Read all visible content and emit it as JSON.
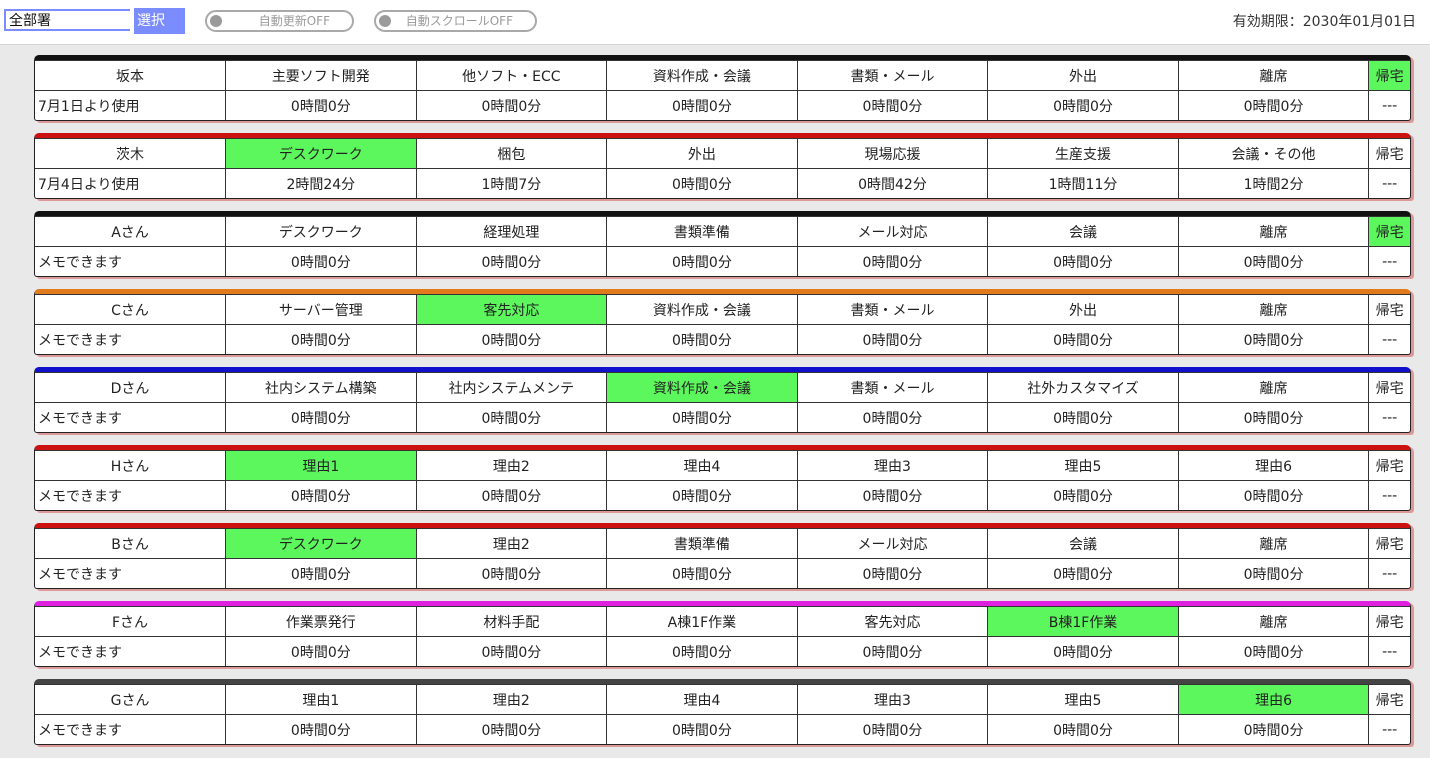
{
  "header": {
    "dept_value": "全部署",
    "select_label": "選択",
    "auto_update_label": "自動更新OFF",
    "auto_scroll_label": "自動スクロールOFF",
    "expiry_text": "有効期限：2030年01月01日"
  },
  "colors": {
    "active_cell": "#5cf75c",
    "select_button": "#7b8cff"
  },
  "panels": [
    {
      "name": "坂本",
      "memo": "7月1日より使用",
      "color": "#111111",
      "active": 7,
      "reasons": [
        "主要ソフト開発",
        "他ソフト・ECC",
        "資料作成・会議",
        "書類・メール",
        "外出",
        "離席"
      ],
      "times": [
        "0時間0分",
        "0時間0分",
        "0時間0分",
        "0時間0分",
        "0時間0分",
        "0時間0分"
      ],
      "home_label": "帰宅",
      "home_value": "---"
    },
    {
      "name": "茨木",
      "memo": "7月4日より使用",
      "color": "#cc1111",
      "active": 1,
      "reasons": [
        "デスクワーク",
        "梱包",
        "外出",
        "現場応援",
        "生産支援",
        "会議・その他"
      ],
      "times": [
        "2時間24分",
        "1時間7分",
        "0時間0分",
        "0時間42分",
        "1時間11分",
        "1時間2分"
      ],
      "home_label": "帰宅",
      "home_value": "---"
    },
    {
      "name": "Aさん",
      "memo": "メモできます",
      "color": "#111111",
      "active": 7,
      "reasons": [
        "デスクワーク",
        "経理処理",
        "書類準備",
        "メール対応",
        "会議",
        "離席"
      ],
      "times": [
        "0時間0分",
        "0時間0分",
        "0時間0分",
        "0時間0分",
        "0時間0分",
        "0時間0分"
      ],
      "home_label": "帰宅",
      "home_value": "---"
    },
    {
      "name": "Cさん",
      "memo": "メモできます",
      "color": "#e07a1a",
      "active": 2,
      "reasons": [
        "サーバー管理",
        "客先対応",
        "資料作成・会議",
        "書類・メール",
        "外出",
        "離席"
      ],
      "times": [
        "0時間0分",
        "0時間0分",
        "0時間0分",
        "0時間0分",
        "0時間0分",
        "0時間0分"
      ],
      "home_label": "帰宅",
      "home_value": "---"
    },
    {
      "name": "Dさん",
      "memo": "メモできます",
      "color": "#1111cc",
      "active": 3,
      "reasons": [
        "社内システム構築",
        "社内システムメンテ",
        "資料作成・会議",
        "書類・メール",
        "社外カスタマイズ",
        "離席"
      ],
      "times": [
        "0時間0分",
        "0時間0分",
        "0時間0分",
        "0時間0分",
        "0時間0分",
        "0時間0分"
      ],
      "home_label": "帰宅",
      "home_value": "---"
    },
    {
      "name": "Hさん",
      "memo": "メモできます",
      "color": "#cc1111",
      "active": 1,
      "reasons": [
        "理由1",
        "理由2",
        "理由4",
        "理由3",
        "理由5",
        "理由6"
      ],
      "times": [
        "0時間0分",
        "0時間0分",
        "0時間0分",
        "0時間0分",
        "0時間0分",
        "0時間0分"
      ],
      "home_label": "帰宅",
      "home_value": "---"
    },
    {
      "name": "Bさん",
      "memo": "メモできます",
      "color": "#cc1111",
      "active": 1,
      "reasons": [
        "デスクワーク",
        "理由2",
        "書類準備",
        "メール対応",
        "会議",
        "離席"
      ],
      "times": [
        "0時間0分",
        "0時間0分",
        "0時間0分",
        "0時間0分",
        "0時間0分",
        "0時間0分"
      ],
      "home_label": "帰宅",
      "home_value": "---"
    },
    {
      "name": "Fさん",
      "memo": "メモできます",
      "color": "#e020e0",
      "active": 5,
      "reasons": [
        "作業票発行",
        "材料手配",
        "A棟1F作業",
        "客先対応",
        "B棟1F作業",
        "離席"
      ],
      "times": [
        "0時間0分",
        "0時間0分",
        "0時間0分",
        "0時間0分",
        "0時間0分",
        "0時間0分"
      ],
      "home_label": "帰宅",
      "home_value": "---"
    },
    {
      "name": "Gさん",
      "memo": "メモできます",
      "color": "#444444",
      "active": 6,
      "reasons": [
        "理由1",
        "理由2",
        "理由4",
        "理由3",
        "理由5",
        "理由6"
      ],
      "times": [
        "0時間0分",
        "0時間0分",
        "0時間0分",
        "0時間0分",
        "0時間0分",
        "0時間0分"
      ],
      "home_label": "帰宅",
      "home_value": "---"
    }
  ]
}
